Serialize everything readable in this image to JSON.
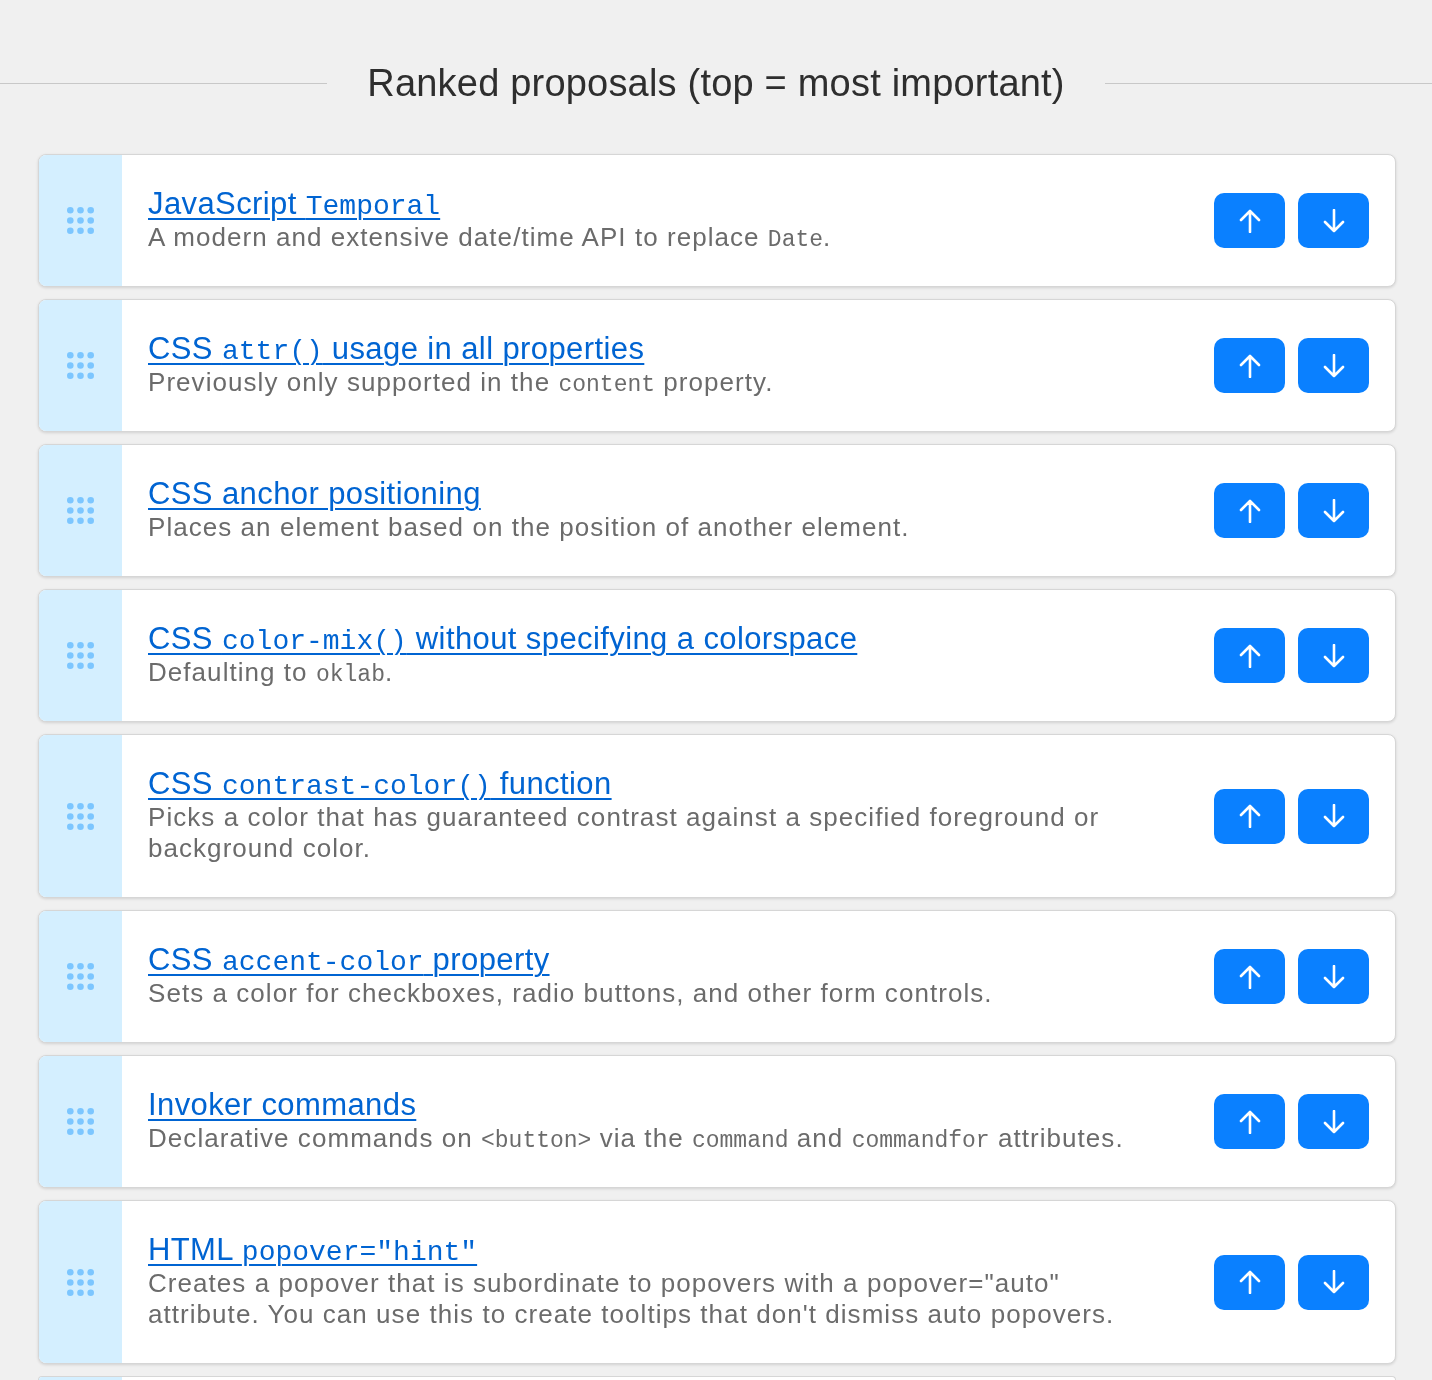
{
  "heading": "Ranked proposals (top = most important)",
  "proposals": [
    {
      "title": [
        {
          "kind": "plain",
          "text": "JavaScript "
        },
        {
          "kind": "code",
          "text": "Temporal"
        }
      ],
      "description": [
        {
          "kind": "plain",
          "text": "A modern and extensive date/time API to replace "
        },
        {
          "kind": "code",
          "text": "Date"
        },
        {
          "kind": "plain",
          "text": "."
        }
      ]
    },
    {
      "title": [
        {
          "kind": "plain",
          "text": "CSS "
        },
        {
          "kind": "code",
          "text": "attr()"
        },
        {
          "kind": "plain",
          "text": " usage in all properties"
        }
      ],
      "description": [
        {
          "kind": "plain",
          "text": "Previously only supported in the "
        },
        {
          "kind": "code",
          "text": "content"
        },
        {
          "kind": "plain",
          "text": " property."
        }
      ]
    },
    {
      "title": [
        {
          "kind": "plain",
          "text": "CSS anchor positioning"
        }
      ],
      "description": [
        {
          "kind": "plain",
          "text": "Places an element based on the position of another element."
        }
      ]
    },
    {
      "title": [
        {
          "kind": "plain",
          "text": "CSS "
        },
        {
          "kind": "code",
          "text": "color-mix()"
        },
        {
          "kind": "plain",
          "text": " without specifying a colorspace"
        }
      ],
      "description": [
        {
          "kind": "plain",
          "text": "Defaulting to "
        },
        {
          "kind": "code",
          "text": "oklab"
        },
        {
          "kind": "plain",
          "text": "."
        }
      ]
    },
    {
      "title": [
        {
          "kind": "plain",
          "text": "CSS "
        },
        {
          "kind": "code",
          "text": "contrast-color()"
        },
        {
          "kind": "plain",
          "text": " function"
        }
      ],
      "description": [
        {
          "kind": "plain",
          "text": "Picks a color that has guaranteed contrast against a specified foreground or background color."
        }
      ]
    },
    {
      "title": [
        {
          "kind": "plain",
          "text": "CSS "
        },
        {
          "kind": "code",
          "text": "accent-color"
        },
        {
          "kind": "plain",
          "text": " property"
        }
      ],
      "description": [
        {
          "kind": "plain",
          "text": "Sets a color for checkboxes, radio buttons, and other form controls."
        }
      ]
    },
    {
      "title": [
        {
          "kind": "plain",
          "text": "Invoker commands"
        }
      ],
      "description": [
        {
          "kind": "plain",
          "text": "Declarative commands on "
        },
        {
          "kind": "code",
          "text": "<button>"
        },
        {
          "kind": "plain",
          "text": " via the "
        },
        {
          "kind": "code",
          "text": "command"
        },
        {
          "kind": "plain",
          "text": " and "
        },
        {
          "kind": "code",
          "text": "commandfor"
        },
        {
          "kind": "plain",
          "text": " attributes."
        }
      ]
    },
    {
      "title": [
        {
          "kind": "plain",
          "text": "HTML "
        },
        {
          "kind": "code",
          "text": "popover=\"hint\""
        }
      ],
      "description": [
        {
          "kind": "plain",
          "text": "Creates a popover that is subordinate to popovers with a popover=\"auto\" attribute. You can use this to create tooltips that don't dismiss auto popovers."
        }
      ]
    }
  ],
  "more_below": true
}
